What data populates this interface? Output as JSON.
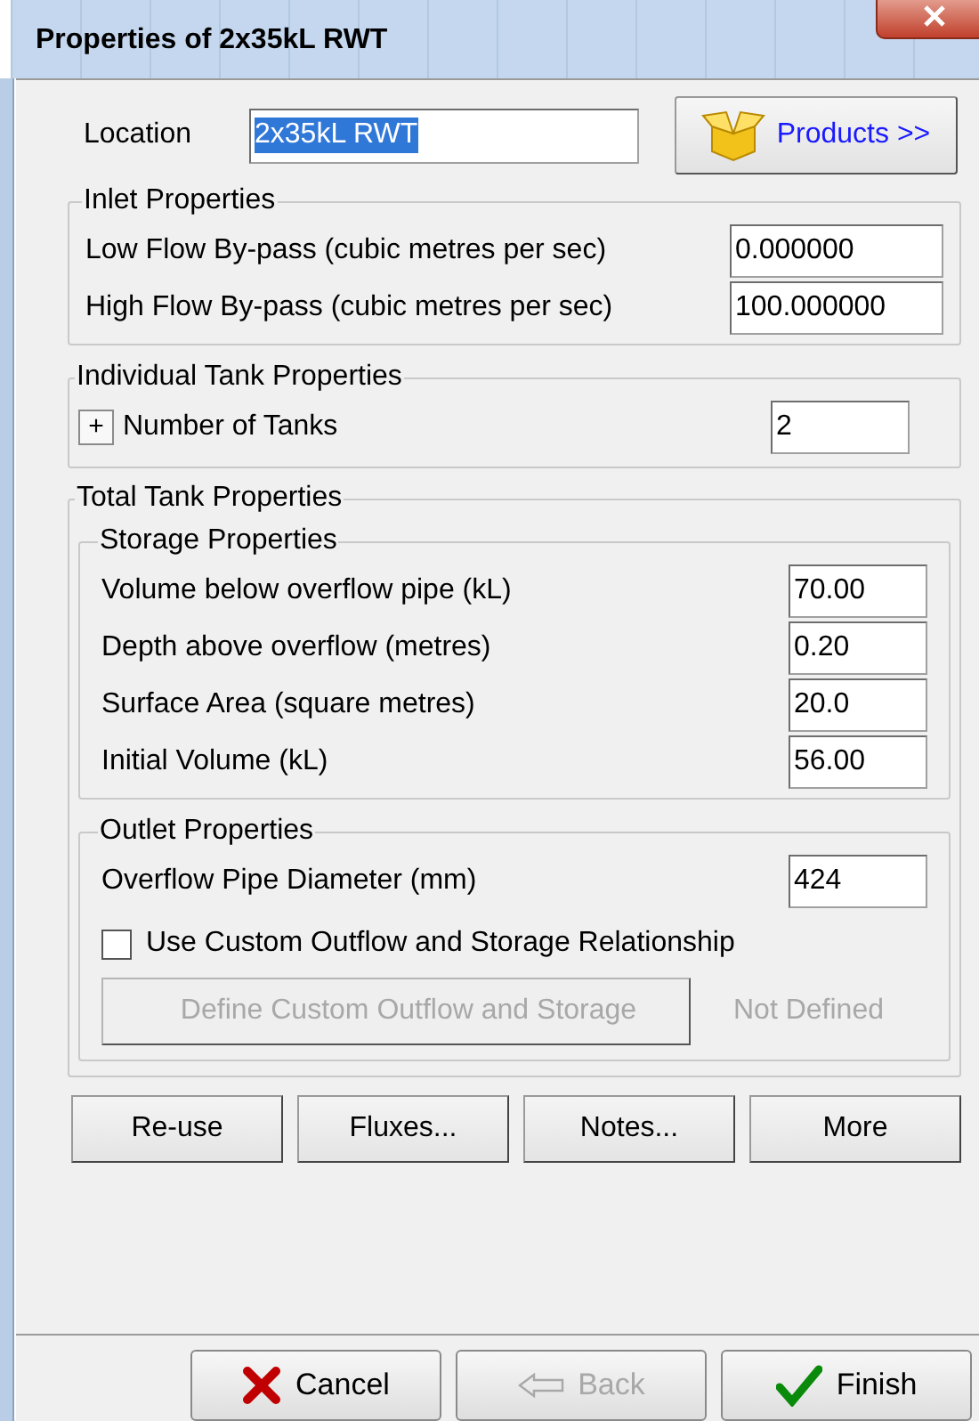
{
  "window": {
    "title": "Properties of 2x35kL RWT"
  },
  "location": {
    "label": "Location",
    "value": "2x35kL RWT",
    "selected": true
  },
  "products_button": "Products >>",
  "inlet": {
    "title": "Inlet Properties",
    "fields": [
      {
        "label": "Low Flow By-pass (cubic metres per sec)",
        "value": "0.000000"
      },
      {
        "label": "High Flow By-pass (cubic metres per sec)",
        "value": "100.000000"
      }
    ]
  },
  "individual": {
    "title": "Individual Tank Properties",
    "expand_button": "+",
    "label": "Number of Tanks",
    "value": "2"
  },
  "total": {
    "title": "Total Tank Properties",
    "storage": {
      "title": "Storage Properties",
      "fields": [
        {
          "label": "Volume below overflow pipe  (kL)",
          "value": "70.00"
        },
        {
          "label": "Depth above overflow (metres)",
          "value": "0.20"
        },
        {
          "label": "Surface Area (square metres)",
          "value": "20.0"
        },
        {
          "label": "Initial Volume (kL)",
          "value": "56.00"
        }
      ]
    },
    "outlet": {
      "title": "Outlet Properties",
      "fields": [
        {
          "label": "Overflow Pipe Diameter (mm)",
          "value": "424"
        }
      ],
      "checkbox": {
        "label": "Use Custom Outflow and Storage Relationship",
        "checked": false
      },
      "define_button": {
        "label": "Define Custom Outflow and Storage",
        "disabled": true
      },
      "status": "Not Defined"
    }
  },
  "action_buttons": [
    "Re-use",
    "Fluxes...",
    "Notes...",
    "More"
  ],
  "footer_buttons": [
    {
      "label": "Cancel",
      "kind": "cancel",
      "disabled": false
    },
    {
      "label": "Back",
      "kind": "back",
      "disabled": true
    },
    {
      "label": "Finish",
      "kind": "finish",
      "disabled": false
    }
  ]
}
